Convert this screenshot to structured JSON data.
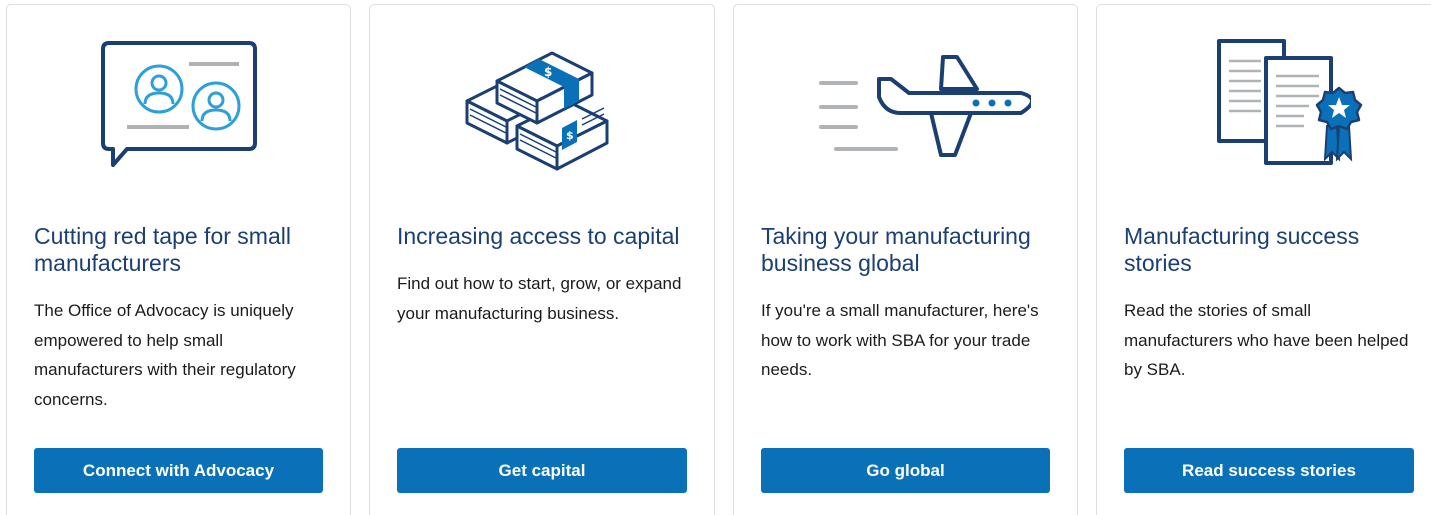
{
  "cards": [
    {
      "icon": "advocacy-speech-bubble-icon",
      "title": "Cutting red tape for small manufacturers",
      "description": "The Office of Advocacy is uniquely empowered to help small manufacturers with their regulatory concerns.",
      "button_label": "Connect with Advocacy"
    },
    {
      "icon": "money-stacks-icon",
      "title": "Increasing access to capital",
      "description": "Find out how to start, grow, or expand your manufacturing business.",
      "button_label": "Get capital"
    },
    {
      "icon": "airplane-icon",
      "title": "Taking your manufacturing business global",
      "description": "If you're a small manufacturer, here's how to work with SBA for your trade needs.",
      "button_label": "Go global"
    },
    {
      "icon": "documents-award-ribbon-icon",
      "title": "Manufacturing success stories",
      "description": "Read the stories of small manufacturers who have been helped by SBA.",
      "button_label": "Read success stories"
    }
  ],
  "colors": {
    "title": "#1b3f73",
    "button": "#0a71b8",
    "icon_navy": "#1b3f73",
    "icon_blue": "#0a71b8",
    "icon_light_blue": "#2e9fd9",
    "icon_gray": "#b0b3b6",
    "card_border": "#dcdee0"
  }
}
